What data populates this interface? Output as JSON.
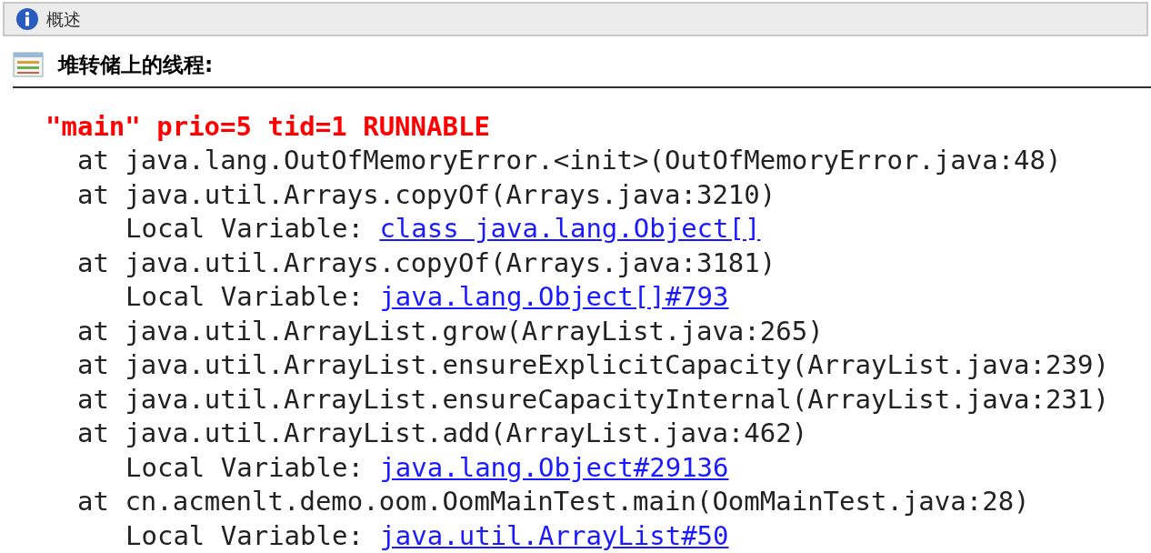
{
  "overview": {
    "title": "概述"
  },
  "section": {
    "title": "堆转储上的线程:"
  },
  "thread": {
    "header": "\"main\" prio=5 tid=1 RUNNABLE",
    "lines": [
      {
        "kind": "frame",
        "text": "at java.lang.OutOfMemoryError.<init>(OutOfMemoryError.java:48)"
      },
      {
        "kind": "frame",
        "text": "at java.util.Arrays.copyOf(Arrays.java:3210)"
      },
      {
        "kind": "local",
        "label": "Local Variable:",
        "link": "class java.lang.Object[]"
      },
      {
        "kind": "frame",
        "text": "at java.util.Arrays.copyOf(Arrays.java:3181)"
      },
      {
        "kind": "local",
        "label": "Local Variable:",
        "link": "java.lang.Object[]#793"
      },
      {
        "kind": "frame",
        "text": "at java.util.ArrayList.grow(ArrayList.java:265)"
      },
      {
        "kind": "frame",
        "text": "at java.util.ArrayList.ensureExplicitCapacity(ArrayList.java:239)"
      },
      {
        "kind": "frame",
        "text": "at java.util.ArrayList.ensureCapacityInternal(ArrayList.java:231)"
      },
      {
        "kind": "frame",
        "text": "at java.util.ArrayList.add(ArrayList.java:462)"
      },
      {
        "kind": "local",
        "label": "Local Variable:",
        "link": "java.lang.Object#29136"
      },
      {
        "kind": "frame",
        "text": "at cn.acmenlt.demo.oom.OomMainTest.main(OomMainTest.java:28)"
      },
      {
        "kind": "local",
        "label": "Local Variable:",
        "link": "java.util.ArrayList#50"
      }
    ]
  }
}
